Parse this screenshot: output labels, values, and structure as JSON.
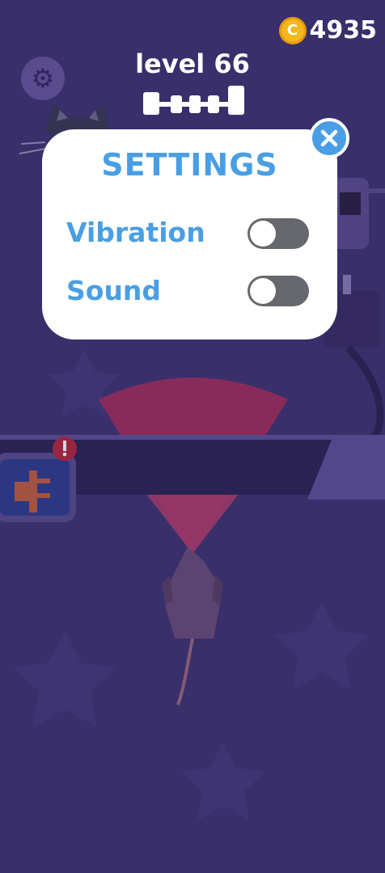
{
  "hud": {
    "coins": "4935",
    "coin_symbol": "C",
    "level_text": "level 66"
  },
  "settings": {
    "title": "SETTINGS",
    "vibration_label": "Vibration",
    "vibration_on": false,
    "sound_label": "Sound",
    "sound_on": false
  },
  "colors": {
    "background": "#3f3573",
    "accent_blue": "#4a9ee3",
    "coin_gold": "#f2b81d",
    "toggle_off": "#66686d"
  },
  "icons": [
    "gear-icon",
    "coin-icon",
    "close-icon",
    "plug-icon",
    "alert-icon",
    "rat-sprite",
    "cat-sprite"
  ]
}
